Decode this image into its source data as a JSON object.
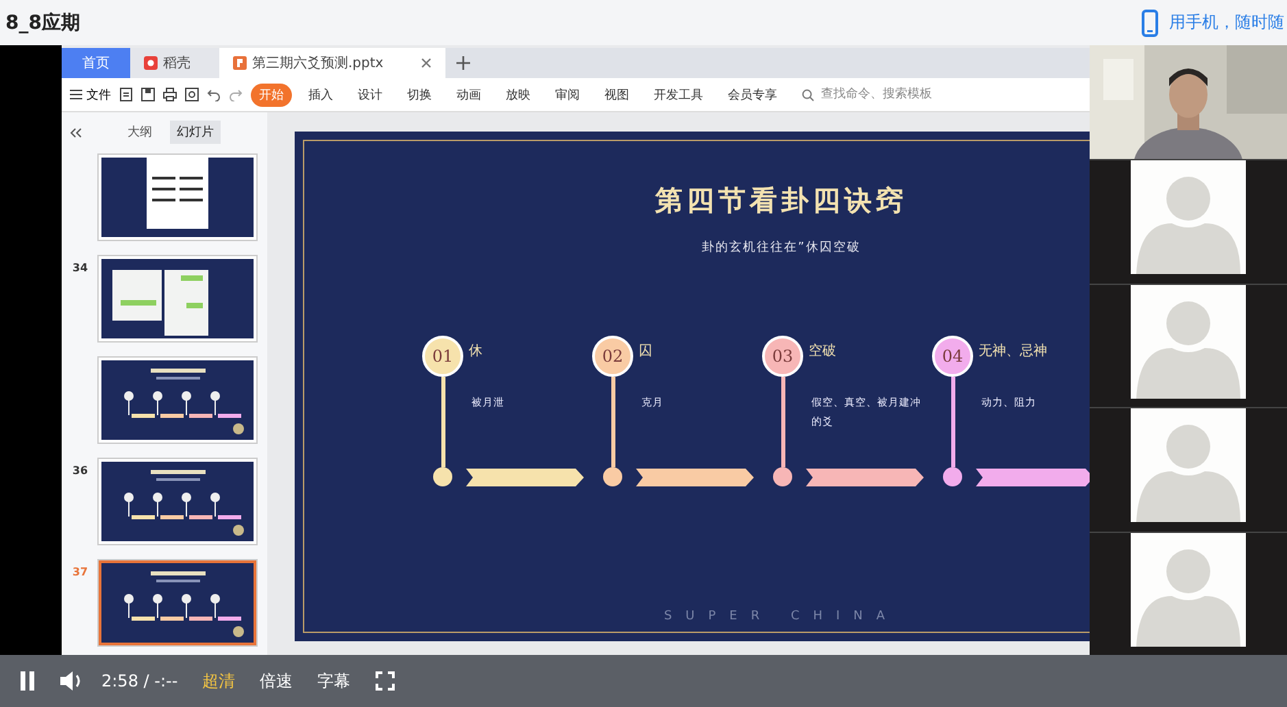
{
  "page_title": "8_8应期",
  "mobile_link": "用手机，随时随",
  "app": {
    "tabs": [
      {
        "label": "首页",
        "kind": "home",
        "selected": false
      },
      {
        "label": "稻壳",
        "kind": "docer",
        "selected": false
      },
      {
        "label": "第三期六爻预测.pptx",
        "kind": "document",
        "selected": true
      }
    ],
    "file_menu": "文件",
    "ribbon_tabs": [
      {
        "label": "开始",
        "selected": true
      },
      {
        "label": "插入",
        "selected": false
      },
      {
        "label": "设计",
        "selected": false
      },
      {
        "label": "切换",
        "selected": false
      },
      {
        "label": "动画",
        "selected": false
      },
      {
        "label": "放映",
        "selected": false
      },
      {
        "label": "审阅",
        "selected": false
      },
      {
        "label": "视图",
        "selected": false
      },
      {
        "label": "开发工具",
        "selected": false
      },
      {
        "label": "会员专享",
        "selected": false
      }
    ],
    "search": {
      "placeholder": "查找命令、搜索模板"
    }
  },
  "panel": {
    "tabs": [
      {
        "label": "大纲",
        "selected": false
      },
      {
        "label": "幻灯片",
        "selected": true
      }
    ],
    "slides": [
      {
        "kind": "table",
        "selected": false
      },
      {
        "number": "34",
        "kind": "chat",
        "selected": false
      },
      {
        "kind": "timeline",
        "selected": false
      },
      {
        "number": "36",
        "kind": "timeline",
        "selected": false
      },
      {
        "number": "37",
        "kind": "timeline",
        "selected": true
      }
    ]
  },
  "slide": {
    "title": "第四节看卦四诀窍",
    "subtitle": "卦的玄机往往在”休囚空破",
    "steps": [
      {
        "number": "01",
        "title": "休",
        "text": "被月泄",
        "color": "#f6e2ac"
      },
      {
        "number": "02",
        "title": "囚",
        "text": "克月",
        "color": "#f9cba4"
      },
      {
        "number": "03",
        "title": "空破",
        "text": "假空、真空、被月建冲的爻",
        "color": "#f7b6b6"
      },
      {
        "number": "04",
        "title": "无神、忌神",
        "text": "动力、阻力",
        "color": "#f2acec"
      }
    ],
    "footer": "SUPER CHINA"
  },
  "participants": [
    {
      "kind": "camera"
    },
    {
      "kind": "avatar"
    },
    {
      "kind": "avatar"
    },
    {
      "kind": "avatar"
    },
    {
      "kind": "avatar"
    }
  ],
  "player": {
    "time": "2:58 / -:--",
    "quality": "超清",
    "speed": "倍速",
    "subtitles": "字幕"
  }
}
